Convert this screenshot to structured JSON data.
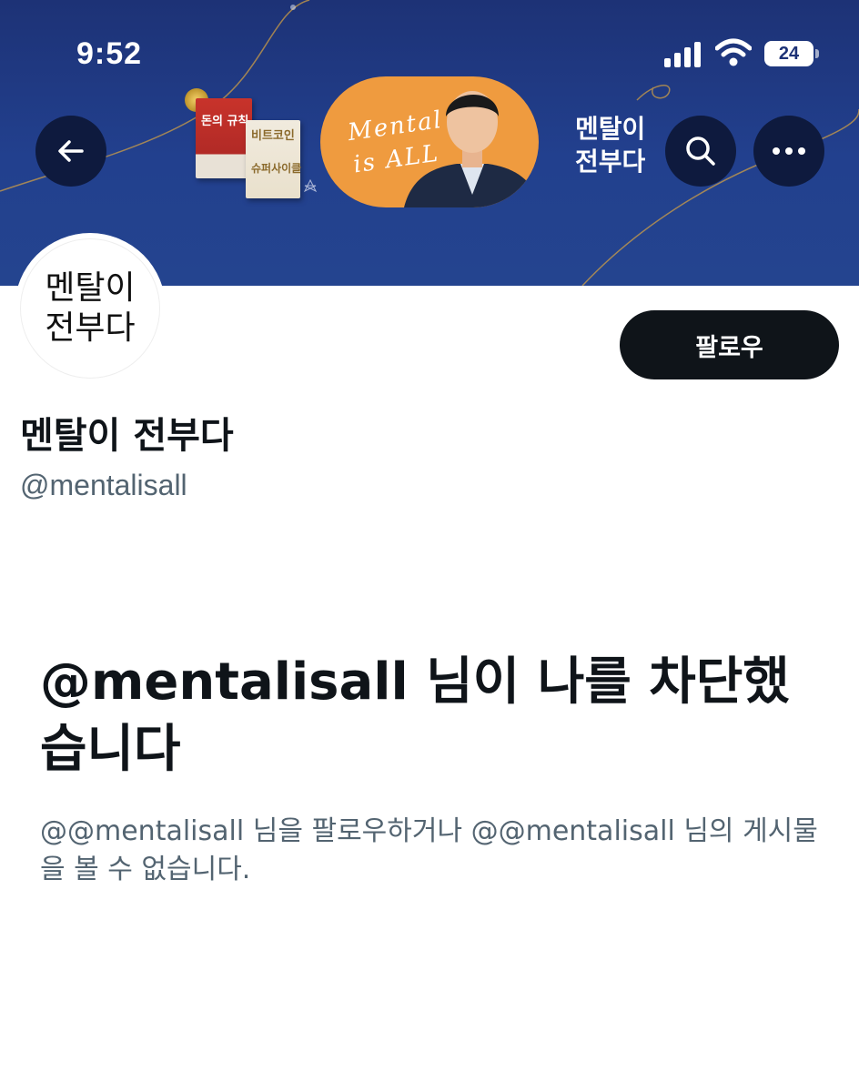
{
  "status_bar": {
    "time": "9:52",
    "battery_level": "24"
  },
  "banner": {
    "book1_title": "돈의 규칙",
    "book2_title": "비트코인",
    "book2_subtitle": "슈퍼사이클",
    "script_line1": "Mental",
    "script_line2": "is ALL",
    "brand_line1": "멘탈이",
    "brand_line2": "전부다"
  },
  "profile": {
    "avatar_line1": "멘탈이",
    "avatar_line2": "전부다",
    "display_name": "멘탈이 전부다",
    "handle": "@mentalisall",
    "follow_label": "팔로우"
  },
  "blocked_notice": {
    "title": "@mentalisall 님이 나를 차단했습니다",
    "description": "@@mentalisall 님을 팔로우하거나 @@mentalisall 님의 게시물을 볼 수 없습니다."
  },
  "icons": {
    "back": "arrow-left-icon",
    "search": "search-icon",
    "more": "more-horizontal-icon",
    "signal": "cellular-signal-icon",
    "wifi": "wifi-icon",
    "battery": "battery-icon"
  },
  "colors": {
    "banner_bg": "#22408e",
    "promo_orange": "#ef9b3f",
    "follow_button_bg": "#0f1419",
    "secondary_text": "#536471"
  }
}
